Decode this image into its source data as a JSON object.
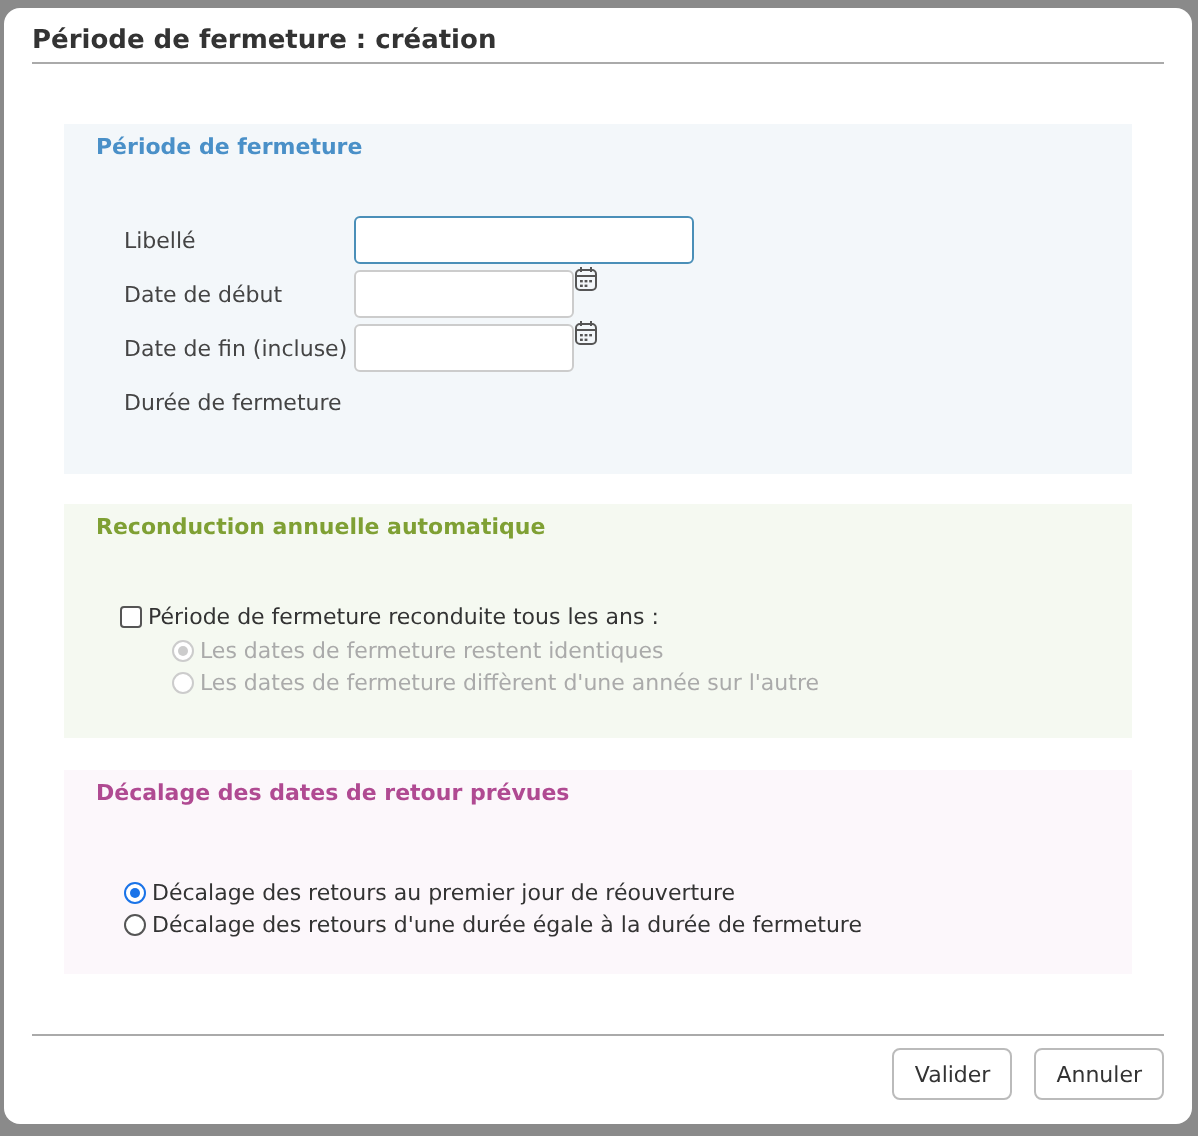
{
  "dialog": {
    "title": "Période de fermeture : création"
  },
  "period": {
    "heading": "Période de fermeture",
    "fields": [
      {
        "kind": "text",
        "label": "Libellé",
        "focused": true
      },
      {
        "kind": "date",
        "label": "Date de début",
        "focused": false
      },
      {
        "kind": "date",
        "label": "Date de fin (incluse)",
        "focused": false
      },
      {
        "kind": "static",
        "label": "Durée de fermeture"
      }
    ]
  },
  "renewal": {
    "heading": "Reconduction annuelle automatique",
    "checkbox": {
      "label": "Période de fermeture reconduite tous les ans :",
      "checked": false
    },
    "options": [
      {
        "label": "Les dates de fermeture restent identiques",
        "selected": true,
        "disabled": true
      },
      {
        "label": "Les dates de fermeture diffèrent d'une année sur l'autre",
        "selected": false,
        "disabled": true
      }
    ]
  },
  "shift": {
    "heading": "Décalage des dates de retour prévues",
    "options": [
      {
        "label": "Décalage des retours au premier jour de réouverture",
        "selected": true,
        "disabled": false
      },
      {
        "label": "Décalage des retours d'une durée égale à la durée de fermeture",
        "selected": false,
        "disabled": false
      }
    ]
  },
  "buttons": [
    "Valider",
    "Annuler"
  ]
}
